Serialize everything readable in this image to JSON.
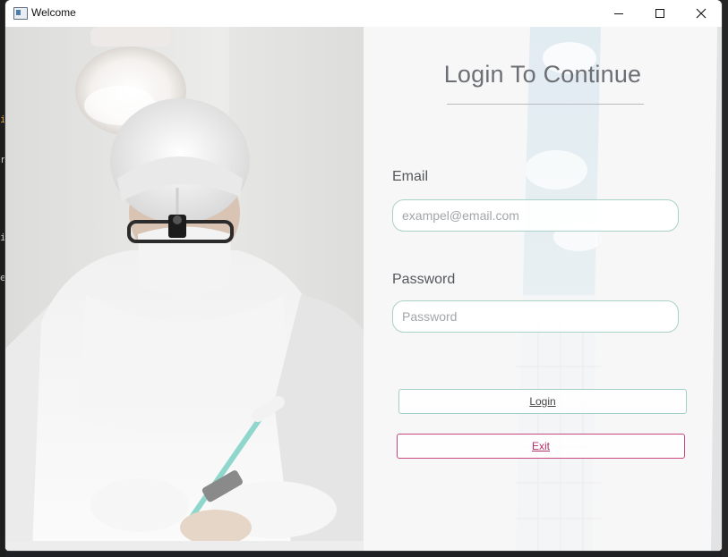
{
  "window": {
    "title": "Welcome",
    "controls": [
      "minimize",
      "maximize",
      "close"
    ]
  },
  "login": {
    "heading": "Login To Continue",
    "email_label": "Email",
    "email_placeholder": "exampel@email.com",
    "email_value": "",
    "password_label": "Password",
    "password_placeholder": "Password",
    "password_value": "",
    "login_button": "Login",
    "exit_button": "Exit"
  },
  "colors": {
    "field_border": "#a9d1c8",
    "login_border": "#a3d0c6",
    "exit_border": "#c8477e",
    "exit_text": "#b0306a",
    "heading_text": "#6c6f73"
  },
  "icons": {
    "app": "app-window-icon",
    "minimize": "minimize-icon",
    "maximize": "maximize-icon",
    "close": "close-icon"
  }
}
